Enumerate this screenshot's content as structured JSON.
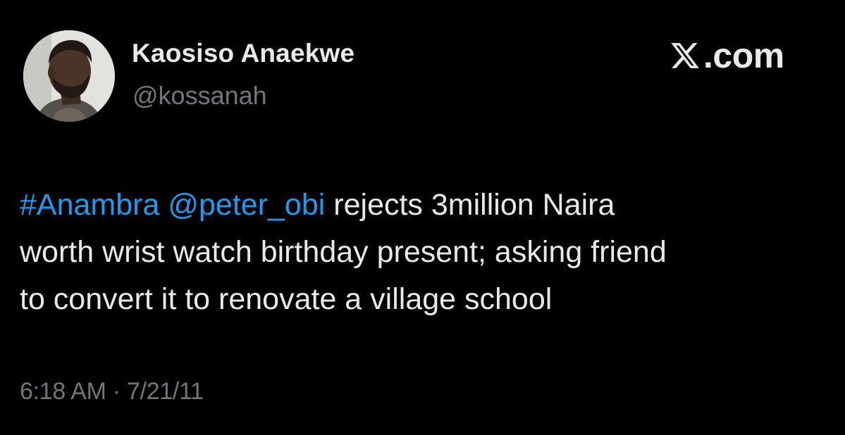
{
  "author": {
    "display_name": "Kaosiso Anaekwe",
    "handle": "@kossanah",
    "avatar_icon": "profile-photo"
  },
  "brand": {
    "logo_icon": "x-logo-icon",
    "text": ".com"
  },
  "tweet": {
    "line1": {
      "hashtag": "#Anambra",
      "mention": "@peter_obi",
      "text": "rejects 3million Naira"
    },
    "line2": "worth wrist watch birthday present; asking friend",
    "line3": "to convert it to renovate a village school"
  },
  "meta": {
    "timestamp": "6:18 AM · 7/21/11"
  },
  "colors": {
    "background": "#000000",
    "primary_text": "#e7e9ea",
    "secondary_text": "#71767b",
    "link": "#1d9bf0"
  }
}
